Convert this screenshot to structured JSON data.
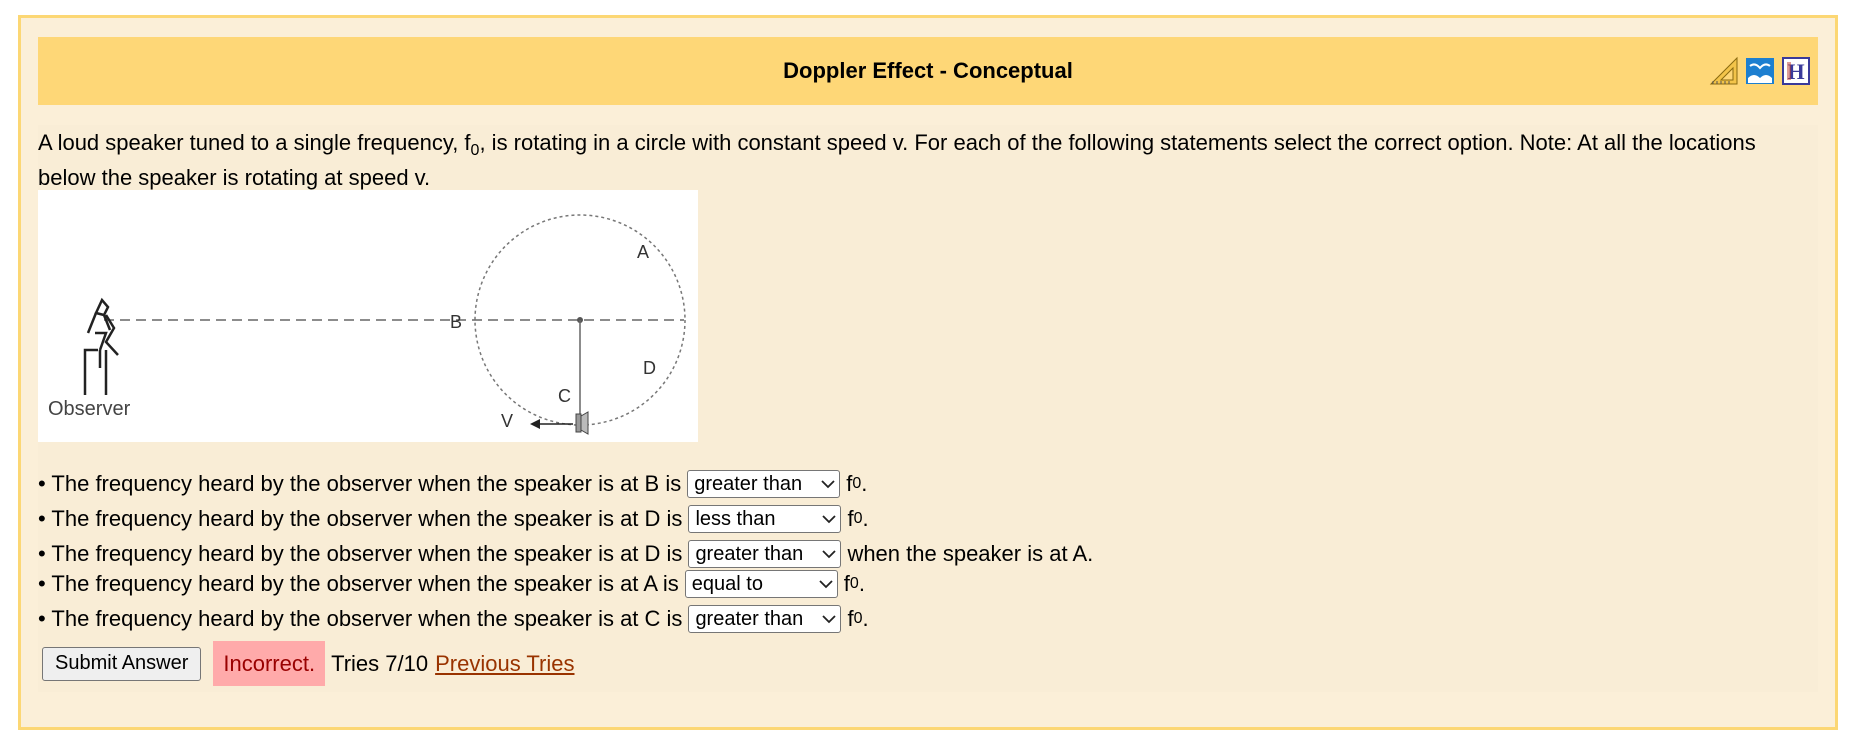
{
  "problem": {
    "title": "Doppler Effect - Conceptual",
    "header_icons": [
      "ruler-triangle-icon",
      "book-icon",
      "help-h-icon"
    ],
    "intro_part1": "A loud speaker tuned to a single frequency, f",
    "intro_sub": "0",
    "intro_part2": ", is rotating in a circle with constant speed v. For each of the following statements select the correct option. Note: At all the locations below the speaker is rotating at speed v."
  },
  "figure": {
    "labels": {
      "a": "A",
      "b": "B",
      "c": "C",
      "d": "D",
      "v": "V",
      "observer": "Observer"
    }
  },
  "statements": [
    {
      "prefix": "• The frequency heard by the observer when the speaker is at B is",
      "selected": "greater than",
      "suffix": "f",
      "suffix_sub": "0",
      "suffix_end": "."
    },
    {
      "prefix": "• The frequency heard by the observer when the speaker is at D is",
      "selected": "less than",
      "suffix": "f",
      "suffix_sub": "0",
      "suffix_end": "."
    },
    {
      "prefix": "• The frequency heard by the observer when the speaker is at D is",
      "selected": "greater than",
      "suffix": "when the speaker is at A.",
      "suffix_sub": "",
      "suffix_end": ""
    },
    {
      "prefix": "• The frequency heard by the observer when the speaker is at A is",
      "selected": "equal to",
      "suffix": "f",
      "suffix_sub": "0",
      "suffix_end": "."
    },
    {
      "prefix": "• The frequency heard by the observer when the speaker is at C is",
      "selected": "greater than",
      "suffix": "f",
      "suffix_sub": "0",
      "suffix_end": "."
    }
  ],
  "controls": {
    "submit_label": "Submit Answer",
    "status": "Incorrect.",
    "tries": "Tries 7/10",
    "previous_tries": "Previous Tries"
  },
  "colors": {
    "header_bg": "#fed777",
    "content_bg": "#f9edd6",
    "status_bg": "#ffaaaa",
    "status_text": "#990000",
    "link": "#993300"
  }
}
